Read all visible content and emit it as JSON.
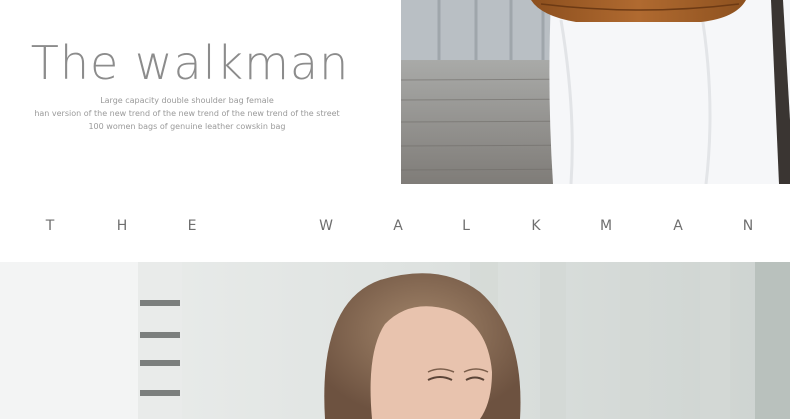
{
  "hero": {
    "title": "The walkman",
    "subtitle_lines": [
      "Large capacity double shoulder bag female",
      "han version of the new trend of the new trend of the new trend of the street",
      "100 women bags of genuine leather cowskin bag"
    ]
  },
  "band": {
    "letters": [
      "T",
      "H",
      "E",
      "W",
      "A",
      "L",
      "K",
      "M",
      "A",
      "N"
    ]
  },
  "photos": {
    "top": {
      "subject": "model-with-brown-leather-bag",
      "colors": {
        "bag": "#a3602a",
        "shirt": "#f7f8fa",
        "deck": "#8d8a86"
      }
    },
    "bottom": {
      "subject": "model-portrait",
      "colors": {
        "hair": "#8a6a52",
        "skin": "#e7c2ad",
        "background": "#e3e6e5"
      }
    }
  }
}
